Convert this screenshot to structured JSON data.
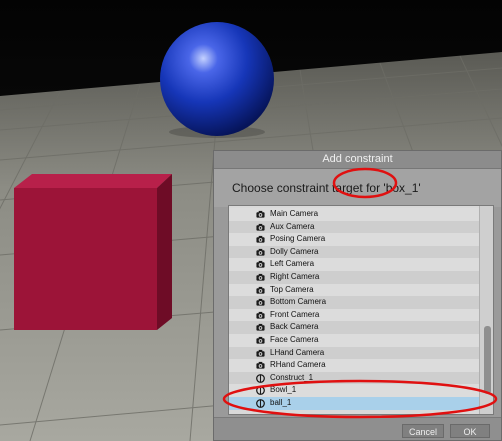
{
  "dialog": {
    "title": "Add constraint",
    "prompt": "Choose constraint target for 'box_1'",
    "items": [
      {
        "label": "Main Camera",
        "icon": "camera-icon"
      },
      {
        "label": "Aux Camera",
        "icon": "camera-icon"
      },
      {
        "label": "Posing Camera",
        "icon": "camera-icon"
      },
      {
        "label": "Dolly Camera",
        "icon": "camera-icon"
      },
      {
        "label": "Left Camera",
        "icon": "camera-icon"
      },
      {
        "label": "Right Camera",
        "icon": "camera-icon"
      },
      {
        "label": "Top Camera",
        "icon": "camera-icon"
      },
      {
        "label": "Bottom Camera",
        "icon": "camera-icon"
      },
      {
        "label": "Front Camera",
        "icon": "camera-icon"
      },
      {
        "label": "Back Camera",
        "icon": "camera-icon"
      },
      {
        "label": "Face Camera",
        "icon": "camera-icon"
      },
      {
        "label": "LHand Camera",
        "icon": "camera-icon"
      },
      {
        "label": "RHand Camera",
        "icon": "camera-icon"
      },
      {
        "label": "Construct_1",
        "icon": "prop-icon"
      },
      {
        "label": "Bowl_1",
        "icon": "prop-icon"
      },
      {
        "label": "ball_1",
        "icon": "prop-icon",
        "selected": true
      }
    ],
    "cancel_label": "Cancel",
    "ok_label": "OK"
  },
  "colors": {
    "selection": "#a9d0ea",
    "row_even": "#dcdcdc",
    "row_odd": "#cecece",
    "highlight_ring": "#e01010",
    "cube": "#9c1438",
    "sphere": "#1534b0"
  }
}
